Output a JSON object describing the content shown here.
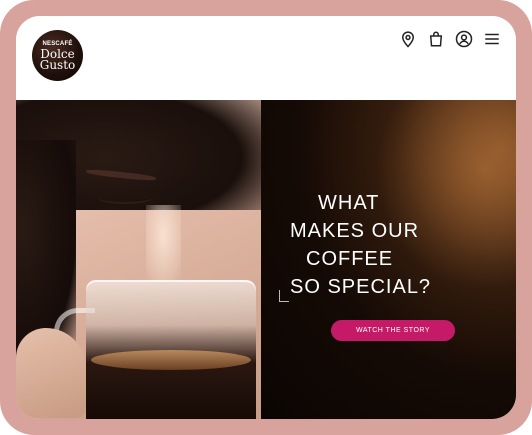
{
  "logo": {
    "brand": "NESCAFÉ",
    "line1": "Dolce",
    "line2": "Gusto"
  },
  "header_icons": [
    "location-pin-icon",
    "shopping-bag-icon",
    "user-account-icon",
    "hamburger-menu-icon"
  ],
  "hero": {
    "headline": [
      "WHAT",
      "MAKES OUR",
      "COFFEE",
      "SO SPECIAL?"
    ],
    "cta_label": "WATCH THE STORY"
  },
  "colors": {
    "frame": "#d9a39d",
    "cta": "#c41a68",
    "dark_panel": "#150a05"
  }
}
